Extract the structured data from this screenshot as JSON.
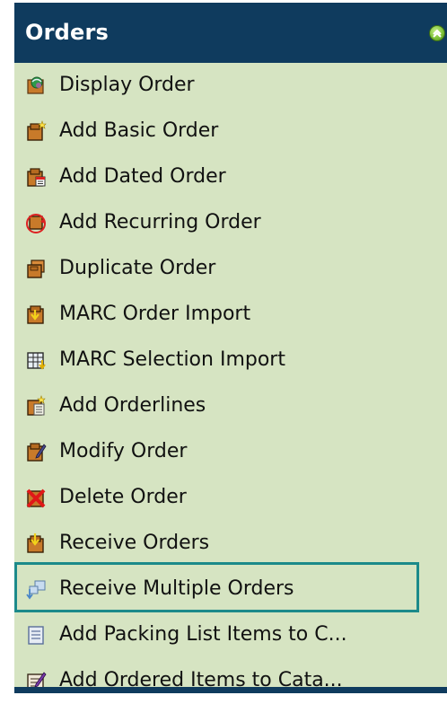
{
  "header": {
    "title": "Orders",
    "collapse_icon": "collapse-up-icon"
  },
  "menu": {
    "items": [
      {
        "label": "Display Order",
        "icon": "display-order-icon"
      },
      {
        "label": "Add Basic Order",
        "icon": "add-basic-order-icon"
      },
      {
        "label": "Add Dated Order",
        "icon": "add-dated-order-icon"
      },
      {
        "label": "Add Recurring Order",
        "icon": "add-recurring-order-icon"
      },
      {
        "label": "Duplicate Order",
        "icon": "duplicate-order-icon"
      },
      {
        "label": "MARC Order Import",
        "icon": "marc-order-import-icon"
      },
      {
        "label": "MARC Selection Import",
        "icon": "marc-selection-import-icon"
      },
      {
        "label": "Add Orderlines",
        "icon": "add-orderlines-icon"
      },
      {
        "label": "Modify Order",
        "icon": "modify-order-icon"
      },
      {
        "label": "Delete Order",
        "icon": "delete-order-icon"
      },
      {
        "label": "Receive Orders",
        "icon": "receive-orders-icon"
      },
      {
        "label": "Receive Multiple Orders",
        "icon": "receive-multiple-orders-icon",
        "highlighted": true
      },
      {
        "label": "Add Packing List Items to C...",
        "icon": "packing-list-icon"
      },
      {
        "label": "Add Ordered Items to Cata...",
        "icon": "add-ordered-items-icon"
      }
    ]
  },
  "colors": {
    "header_bg": "#0f3b5e",
    "panel_bg": "#d6e4c2",
    "highlight_border": "#1c8a8a",
    "text": "#111111"
  }
}
